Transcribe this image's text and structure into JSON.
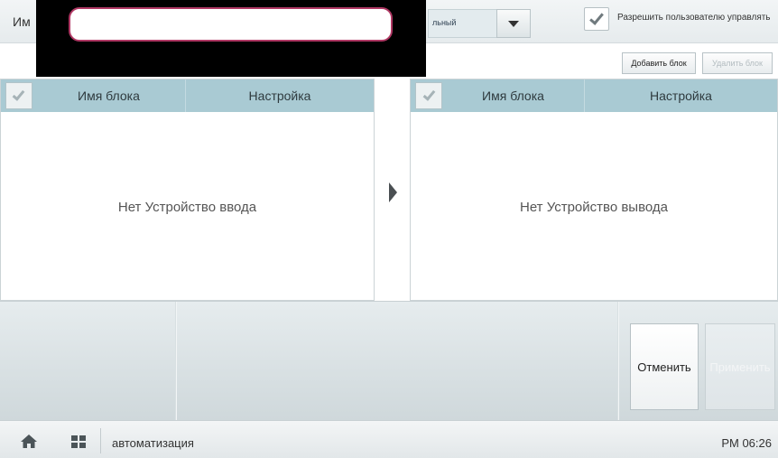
{
  "header": {
    "name_label": "Им",
    "name_value": "",
    "mode_value": "льный",
    "allow_user_control_label": "Разрешить пользователю управлять",
    "allow_user_control_checked": true
  },
  "toolbar": {
    "add_block_label": "Добавить блок",
    "delete_block_label": "Удалить блок"
  },
  "input_panel": {
    "columns": [
      "Имя блока",
      "Настройка"
    ],
    "empty_text": "Нет Устройство ввода"
  },
  "output_panel": {
    "columns": [
      "Имя блока",
      "Настройка"
    ],
    "empty_text": "Нет Устройство вывода"
  },
  "actions": {
    "cancel_label": "Отменить",
    "apply_label": "Применить"
  },
  "footer": {
    "title": "автоматизация",
    "time": "PM 06:26"
  }
}
